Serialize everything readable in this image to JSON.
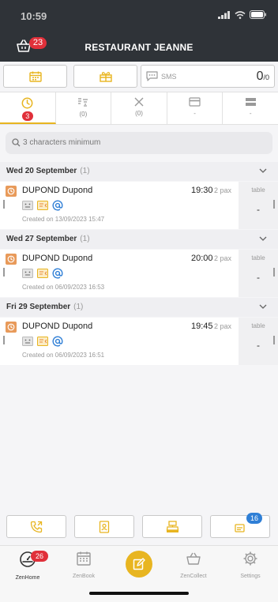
{
  "status": {
    "time": "10:59"
  },
  "header": {
    "title": "RESTAURANT JEANNE",
    "basket_count": "23"
  },
  "sms": {
    "label": "SMS",
    "count": "0",
    "total": "0"
  },
  "tabs": [
    {
      "icon": "clock-icon",
      "badge": "3",
      "count": ""
    },
    {
      "icon": "sort-icon",
      "badge": "",
      "count": "(0)"
    },
    {
      "icon": "cancel-icon",
      "badge": "",
      "count": "(0)"
    },
    {
      "icon": "card-icon",
      "badge": "",
      "count": "-"
    },
    {
      "icon": "list-icon",
      "badge": "",
      "count": "-"
    }
  ],
  "search": {
    "placeholder": "3 characters minimum"
  },
  "days": [
    {
      "label": "Wed 20 September",
      "count": "(1)",
      "booking": {
        "name": "DUPOND Dupond",
        "time": "19:30",
        "pax": "2 pax",
        "created": "Created on 13/09/2023 15:47",
        "table_label": "table",
        "table_value": "-"
      }
    },
    {
      "label": "Wed 27 September",
      "count": "(1)",
      "booking": {
        "name": "DUPOND Dupond",
        "time": "20:00",
        "pax": "2 pax",
        "created": "Created on 06/09/2023 16:53",
        "table_label": "table",
        "table_value": "-"
      }
    },
    {
      "label": "Fri 29 September",
      "count": "(1)",
      "booking": {
        "name": "DUPOND Dupond",
        "time": "19:45",
        "pax": "2 pax",
        "created": "Created on 06/09/2023 16:51",
        "table_label": "table",
        "table_value": "-"
      }
    }
  ],
  "quick_actions": {
    "badge": "16"
  },
  "tabbar": {
    "items": [
      {
        "label": "ZenHome",
        "badge": "26"
      },
      {
        "label": "ZenBook"
      },
      {
        "label": ""
      },
      {
        "label": "ZenCollect"
      },
      {
        "label": "Settings"
      }
    ]
  },
  "colors": {
    "accent": "#e8b520",
    "header": "#2f3338",
    "badge_red": "#e0303a",
    "badge_blue": "#2f7fd6"
  }
}
